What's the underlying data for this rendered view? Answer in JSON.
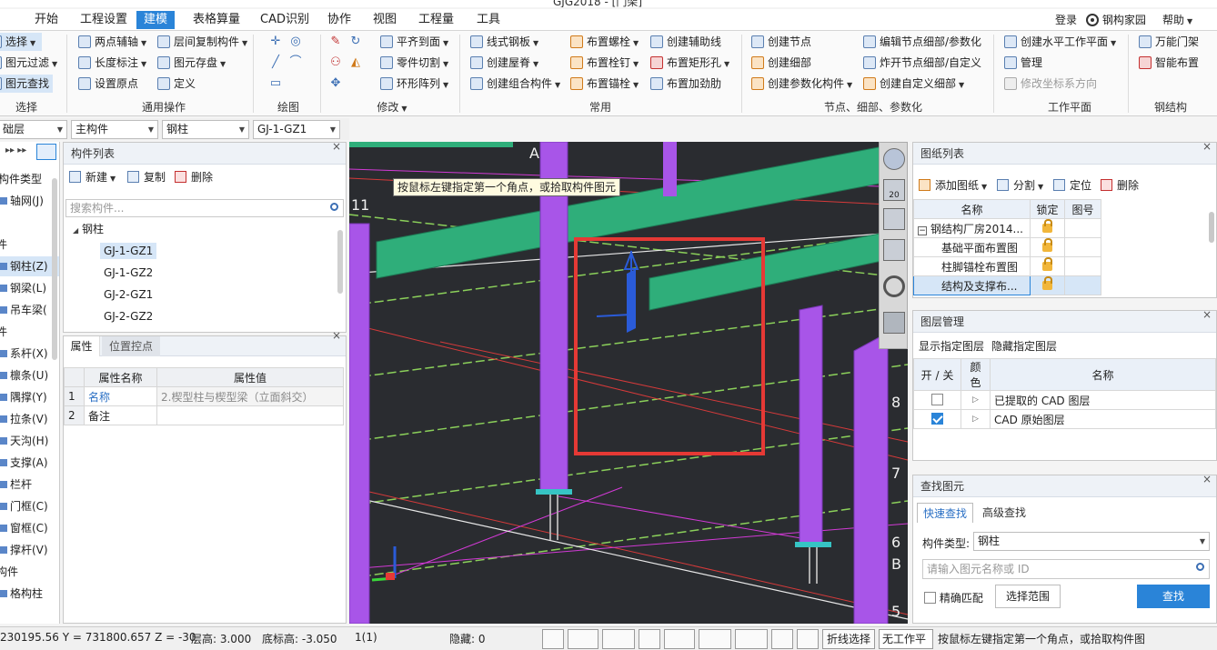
{
  "window": {
    "title": "GJG2018 - [门架]"
  },
  "menu": {
    "tabs": [
      "开始",
      "工程设置",
      "建模",
      "表格算量",
      "CAD识别",
      "协作",
      "视图",
      "工程量",
      "工具"
    ],
    "active": "建模",
    "login": "登录",
    "home": "钢构家园",
    "help": "帮助"
  },
  "ribbon": {
    "select": {
      "b1": "选择",
      "b2": "图元过滤",
      "b3": "图元查找",
      "group": "选择"
    },
    "common_ops": {
      "b1": "两点辅轴",
      "b2": "长度标注",
      "b3": "设置原点",
      "b4": "层间复制构件",
      "b5": "图元存盘",
      "b6": "定义",
      "group": "通用操作"
    },
    "draw": {
      "group": "绘图"
    },
    "modify": {
      "b1": "平齐到面",
      "b2": "零件切割",
      "b3": "环形阵列",
      "group": "修改"
    },
    "common": {
      "b1": "线式钢板",
      "b2": "创建屋脊",
      "b3": "创建组合构件",
      "b4": "布置螺栓",
      "b5": "布置栓钉",
      "b6": "布置锚栓",
      "b7": "创建辅助线",
      "b8": "布置矩形孔",
      "b9": "布置加劲肋",
      "group": "常用"
    },
    "nodes": {
      "b1": "创建节点",
      "b2": "创建细部",
      "b3": "创建参数化构件",
      "b4": "编辑节点细部/参数化",
      "b5": "炸开节点细部/自定义",
      "b6": "创建自定义细部",
      "group": "节点、细部、参数化"
    },
    "plane": {
      "b1": "创建水平工作平面",
      "b2": "管理",
      "b3": "修改坐标系方向",
      "group": "工作平面"
    },
    "steel": {
      "b1": "万能门架",
      "b2": "智能布置",
      "group": "钢结构"
    }
  },
  "selectors": {
    "floor": "础层",
    "type": "主构件",
    "category": "钢柱",
    "component": "GJ-1-GZ1"
  },
  "leftnav": {
    "items": [
      "构件类型",
      "轴网(J)",
      "件",
      "钢柱(Z)",
      "钢梁(L)",
      "吊车梁(",
      "件",
      "系杆(X)",
      "檩条(U)",
      "隅撑(Y)",
      "拉条(V)",
      "天沟(H)",
      "支撑(A)",
      "栏杆",
      "门框(C)",
      "窗框(C)",
      "撑杆(V)",
      "构件",
      "格构柱"
    ]
  },
  "component_list": {
    "title": "构件列表",
    "new": "新建",
    "copy": "复制",
    "delete": "删除",
    "search_placeholder": "搜索构件...",
    "root": "钢柱",
    "items": [
      "GJ-1-GZ1",
      "GJ-1-GZ2",
      "GJ-2-GZ1",
      "GJ-2-GZ2"
    ]
  },
  "properties": {
    "tab1": "属性",
    "tab2": "位置控点",
    "col_name": "属性名称",
    "col_value": "属性值",
    "rows": [
      {
        "no": "1",
        "name": "名称",
        "value": "2.楔型柱与楔型梁（立面斜交）"
      },
      {
        "no": "2",
        "name": "备注",
        "value": ""
      }
    ]
  },
  "viewport": {
    "tooltip": "按鼠标左键指定第一个角点，或拾取构件图元",
    "axis_labels": [
      "A",
      "11",
      "8",
      "7",
      "6",
      "B",
      "5"
    ],
    "nav_scale": "20"
  },
  "drawings": {
    "title": "图纸列表",
    "add": "添加图纸",
    "split": "分割",
    "locate": "定位",
    "delete": "删除",
    "col_name": "名称",
    "col_lock": "锁定",
    "col_no": "图号",
    "rows": [
      "钢结构厂房2014...",
      "基础平面布置图",
      "柱脚锚栓布置图",
      "结构及支撑布..."
    ]
  },
  "layers": {
    "title": "图层管理",
    "show": "显示指定图层",
    "hide": "隐藏指定图层",
    "col_onoff": "开 / 关",
    "col_color": "颜色",
    "col_name": "名称",
    "rows": [
      {
        "name": "已提取的 CAD 图层",
        "on": false
      },
      {
        "name": "CAD 原始图层",
        "on": true
      }
    ]
  },
  "find": {
    "title": "查找图元",
    "tab1": "快速查找",
    "tab2": "高级查找",
    "type_label": "构件类型:",
    "type_value": "钢柱",
    "input_placeholder": "请输入图元名称或 ID",
    "exact": "精确匹配",
    "range": "选择范围",
    "search": "查找"
  },
  "status": {
    "coords": "230195.56 Y = 731800.657 Z = -30",
    "floor_height": "层高: 3.000",
    "bottom": "底标高: -3.050",
    "count": "1(1)",
    "hidden": "隐藏: 0",
    "polyline": "折线选择",
    "no_plane": "无工作平",
    "hint": "按鼠标左键指定第一个角点，或拾取构件图"
  },
  "colors": {
    "accent": "#2a84d8",
    "column": "#a855e8",
    "beam": "#2fae7a",
    "marker": "#e53935"
  }
}
